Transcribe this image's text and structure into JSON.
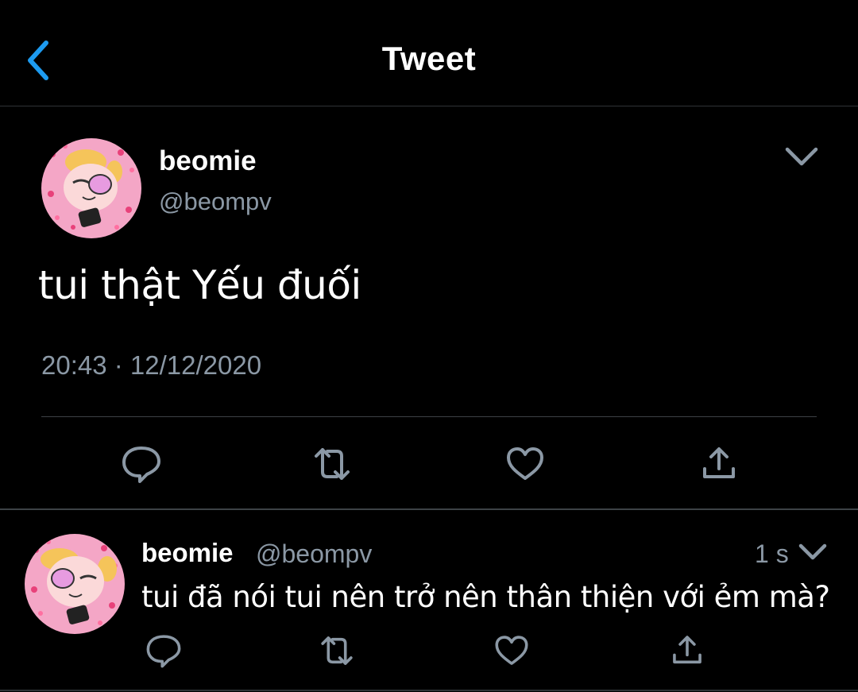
{
  "header": {
    "title": "Tweet",
    "back_icon": "chevron-left-icon",
    "accent": "#1d9bf0"
  },
  "tweet": {
    "display_name": "beomie",
    "handle": "@beompv",
    "text": "tui thật Yếu đuối",
    "timestamp": "20:43 · 12/12/2020",
    "avatar": "profile-avatar",
    "actions": [
      "reply-icon",
      "retweet-icon",
      "like-icon",
      "share-icon"
    ]
  },
  "reply": {
    "display_name": "beomie",
    "handle": "@beompv",
    "time": "1 s",
    "text": "tui đã nói tui nên trở nên thân thiện với ẻm mà?",
    "avatar": "profile-avatar",
    "actions": [
      "reply-icon",
      "retweet-icon",
      "like-icon",
      "share-icon"
    ]
  },
  "colors": {
    "background": "#000000",
    "secondary_text": "#8b98a5",
    "divider": "#2f3336"
  }
}
